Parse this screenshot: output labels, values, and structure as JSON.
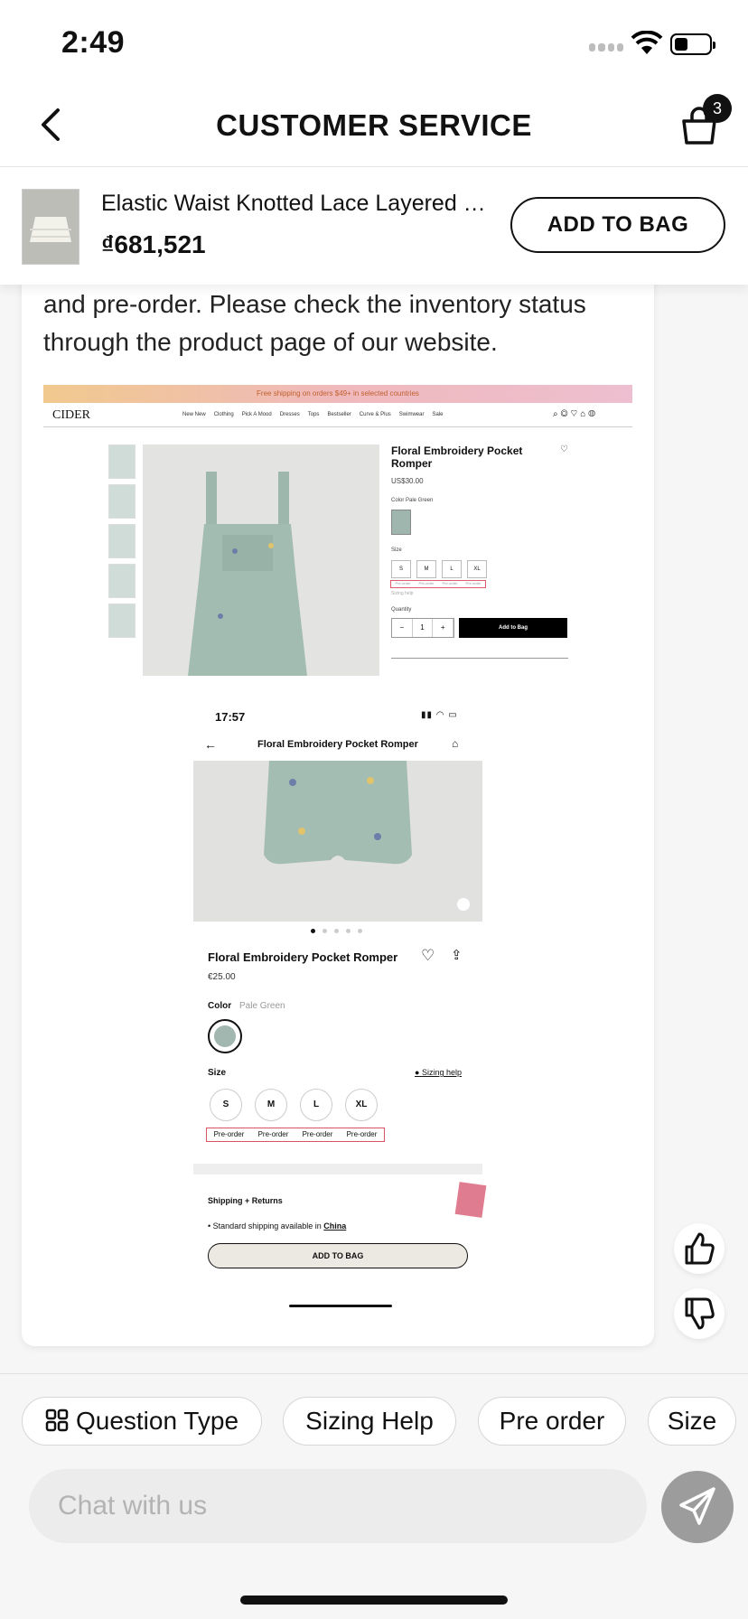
{
  "status_bar": {
    "time": "2:49"
  },
  "nav": {
    "title": "CUSTOMER SERVICE",
    "bag_count": "3"
  },
  "product": {
    "name": "Elastic Waist Knotted Lace Layered Mini Skirt",
    "price": "₫681,521",
    "add_button": "ADD TO BAG"
  },
  "message": {
    "text": "and pre-order. Please check the inventory status through the product page of our website."
  },
  "desktop_shot": {
    "banner": "Free shipping on orders $49+ in selected countries",
    "logo": "CIDER",
    "menu": [
      "New New",
      "Clothing",
      "Pick A Mood",
      "Dresses",
      "Tops",
      "Bestseller",
      "Curve & Plus",
      "Swimwear",
      "Sale"
    ],
    "title": "Floral Embroidery Pocket Romper",
    "price": "US$30.00",
    "color_label": "Color  Pale Green",
    "size_label": "Size",
    "sizes": [
      "S",
      "M",
      "L",
      "XL"
    ],
    "preorder": [
      "Pre-order",
      "Pre-order",
      "Pre-order",
      "Pre-order"
    ],
    "sizing_help": "Sizing help",
    "quantity_label": "Quantity",
    "qty": [
      "−",
      "1",
      "+"
    ],
    "add_button": "Add to Bag"
  },
  "mobile_shot": {
    "time": "17:57",
    "title": "Floral Embroidery Pocket Romper",
    "name": "Floral Embroidery Pocket Romper",
    "price": "€25.00",
    "color_label": "Color",
    "color_value": "Pale Green",
    "size_label": "Size",
    "sizing_help": "Sizing help",
    "sizes": [
      "S",
      "M",
      "L",
      "XL"
    ],
    "preorder": [
      "Pre-order",
      "Pre-order",
      "Pre-order",
      "Pre-order"
    ],
    "shipping_title": "Shipping + Returns",
    "shipping_line_prefix": "Standard shipping available in ",
    "shipping_country": "China",
    "add_button": "ADD TO BAG"
  },
  "chips": [
    "Question Type",
    "Sizing Help",
    "Pre order",
    "Size"
  ],
  "input": {
    "placeholder": "Chat with us"
  },
  "colors": {
    "accent": "#111111",
    "send_button": "#9c9c9c",
    "preorder_border": "#d85462"
  }
}
